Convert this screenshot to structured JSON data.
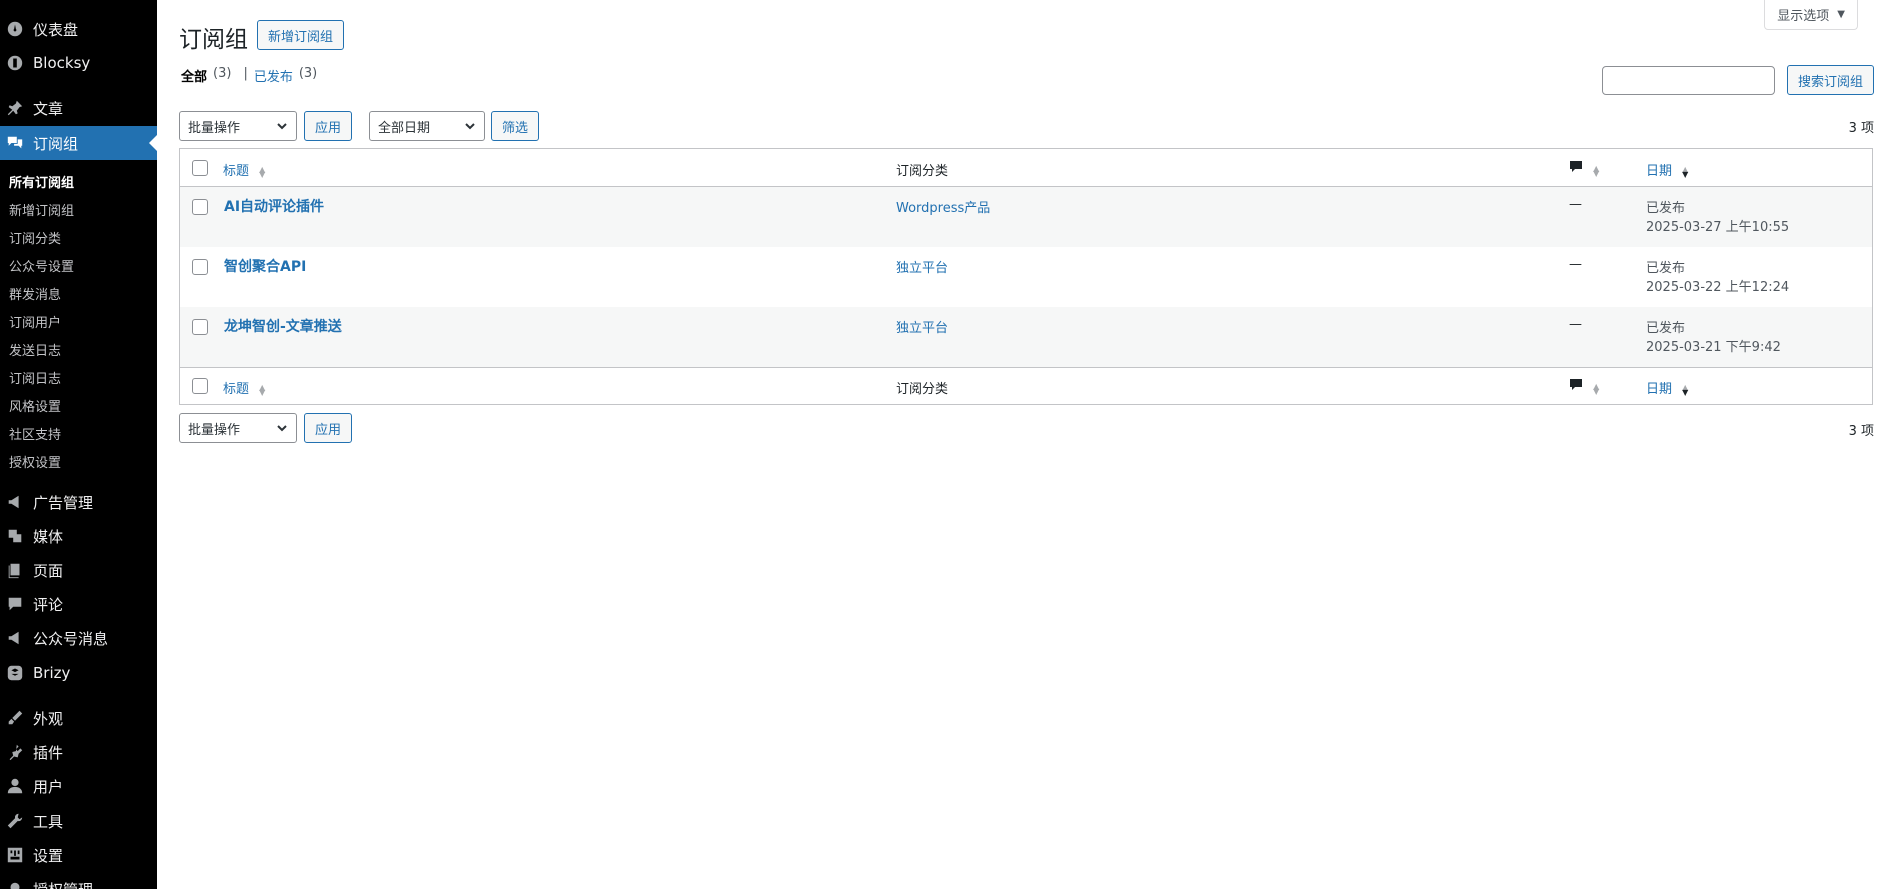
{
  "sidebar": {
    "items": [
      {
        "label": "仪表盘",
        "icon": "dashboard-icon"
      },
      {
        "label": "Blocksy",
        "icon": "blocksy-icon"
      },
      {
        "label": "文章",
        "icon": "pushpin-icon"
      },
      {
        "label": "订阅组",
        "icon": "comments-icon"
      },
      {
        "label": "广告管理",
        "icon": "megaphone-icon"
      },
      {
        "label": "媒体",
        "icon": "media-icon"
      },
      {
        "label": "页面",
        "icon": "page-icon"
      },
      {
        "label": "评论",
        "icon": "comment-icon"
      },
      {
        "label": "公众号消息",
        "icon": "megaphone-icon"
      },
      {
        "label": "Brizy",
        "icon": "brizy-icon"
      },
      {
        "label": "外观",
        "icon": "brush-icon"
      },
      {
        "label": "插件",
        "icon": "plugin-icon"
      },
      {
        "label": "用户",
        "icon": "user-icon"
      },
      {
        "label": "工具",
        "icon": "wrench-icon"
      },
      {
        "label": "设置",
        "icon": "settings-icon"
      },
      {
        "label": "授权管理",
        "icon": "lock-icon"
      }
    ],
    "submenu": [
      "所有订阅组",
      "新增订阅组",
      "订阅分类",
      "公众号设置",
      "群发消息",
      "订阅用户",
      "发送日志",
      "订阅日志",
      "风格设置",
      "社区支持",
      "授权设置"
    ]
  },
  "header": {
    "screen_options": "显示选项",
    "title": "订阅组",
    "add_new": "新增订阅组"
  },
  "filters": {
    "all_label": "全部",
    "all_count": "(3)",
    "separator": "|",
    "published_label": "已发布",
    "published_count": "(3)",
    "search_button": "搜索订阅组",
    "bulk_actions": "批量操作",
    "apply": "应用",
    "all_dates": "全部日期",
    "filter": "筛选",
    "items_count": "3 项"
  },
  "table": {
    "columns": {
      "title": "标题",
      "category": "订阅分类",
      "date": "日期"
    },
    "rows": [
      {
        "title": "AI自动评论插件",
        "category": "Wordpress产品",
        "comments": "—",
        "status": "已发布",
        "date": "2025-03-27 上午10:55"
      },
      {
        "title": "智创聚合API",
        "category": "独立平台",
        "comments": "—",
        "status": "已发布",
        "date": "2025-03-22 上午12:24"
      },
      {
        "title": "龙坤智创-文章推送",
        "category": "独立平台",
        "comments": "—",
        "status": "已发布",
        "date": "2025-03-21 下午9:42"
      }
    ]
  },
  "colors": {
    "sidebar_bg": "#000000",
    "active_bg": "#2271b1",
    "link": "#2271b1"
  }
}
